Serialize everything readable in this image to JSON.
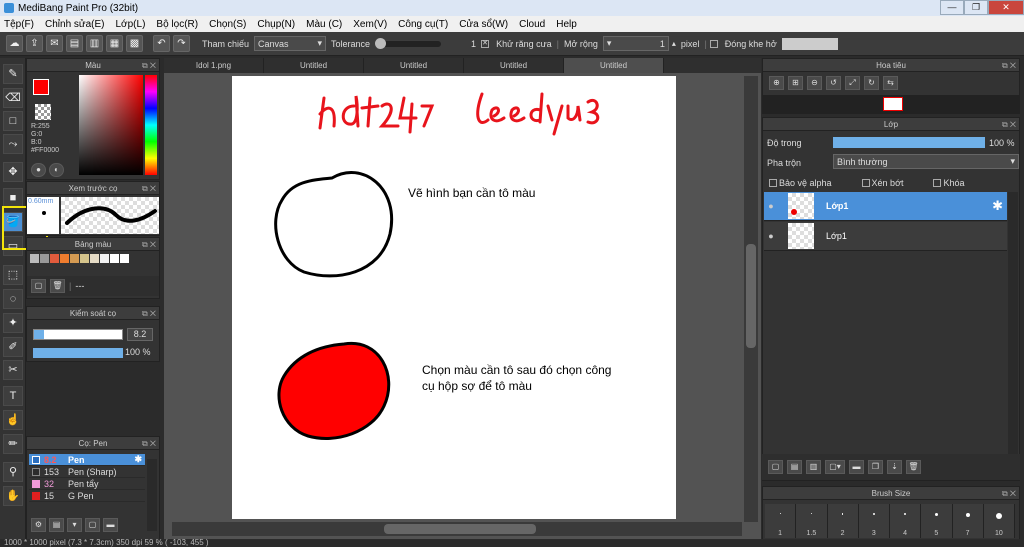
{
  "window": {
    "title": "MediBang Paint Pro (32bit)",
    "min": "—",
    "max": "❐",
    "close": "✕"
  },
  "menu": [
    "Tệp(F)",
    "Chỉnh sửa(E)",
    "Lớp(L)",
    "Bộ lọc(R)",
    "Chọn(S)",
    "Chụp(N)",
    "Màu (C)",
    "Xem(V)",
    "Công cụ(T)",
    "Cửa sổ(W)",
    "Cloud",
    "Help"
  ],
  "toolbar": {
    "ref_label": "Tham chiếu",
    "ref_value": "Canvas",
    "tolerance_label": "Tolerance",
    "tolerance_value": "1",
    "antialias_label": "Khử răng cưa",
    "expand_label": "Mở rộng",
    "expand_value": "1",
    "expand_unit": "pixel",
    "close_gap_label": "Đóng khe hở",
    "check": "✕"
  },
  "color_panel": {
    "title": "Màu",
    "r": "R:255",
    "g": "G:0",
    "b": "B:0",
    "hex": "#FF0000",
    "color": "#ff0000"
  },
  "brush_preview": {
    "title": "Xem trước cọ",
    "size": "0.60mm"
  },
  "palette": {
    "title": "Bảng màu",
    "more": "---",
    "colors": [
      "#bbbbbb",
      "#999999",
      "#e25b3c",
      "#ef7c2e",
      "#d49a52",
      "#d5c48b",
      "#e6dcc6",
      "#f2f2f2",
      "#ffffff",
      "#ffffff"
    ]
  },
  "brush_control": {
    "title": "Kiểm soát cọ",
    "size": "8.2",
    "opacity": "100 %"
  },
  "brush_list": {
    "title": "Cọ: Pen",
    "items": [
      {
        "size": "8.2",
        "name": "Pen",
        "color": "#2c6fbf"
      },
      {
        "size": "153",
        "name": "Pen (Sharp)",
        "color": "#2c2c2c"
      },
      {
        "size": "32",
        "name": "Pen tẩy",
        "color": "#f09ad8"
      },
      {
        "size": "15",
        "name": "G Pen",
        "color": "#e02020"
      }
    ]
  },
  "tabs": [
    "Idol 1.png",
    "Untitled",
    "Untitled",
    "Untitled",
    "Untitled"
  ],
  "canvas": {
    "text1": "Vẽ hình bạn cần tô màu",
    "text2_line1": "Chọn màu cần tô sau đó chọn công",
    "text2_line2": "cụ hộp sợ để tô màu",
    "signature1": "hd247",
    "signature2": "leedyu3"
  },
  "navigator": {
    "title": "Hoa tiêu"
  },
  "layer_panel": {
    "title": "Lớp",
    "opacity_label": "Độ trong",
    "opacity_value": "100 %",
    "blend_label": "Pha trộn",
    "blend_value": "Bình thường",
    "protect_alpha": "Bảo vệ alpha",
    "clip": "Xén bớt",
    "lock": "Khóa",
    "layers": [
      {
        "name": "Lớp1"
      },
      {
        "name": "Lớp1"
      }
    ]
  },
  "brush_size_panel": {
    "title": "Brush Size",
    "sizes": [
      "1",
      "1.5",
      "2",
      "3",
      "4",
      "5",
      "7",
      "10"
    ]
  },
  "status": {
    "text": "1000 * 1000 pixel  (7.3 * 7.3cm)  350 dpi  59 %  ( -103, 455 )"
  }
}
